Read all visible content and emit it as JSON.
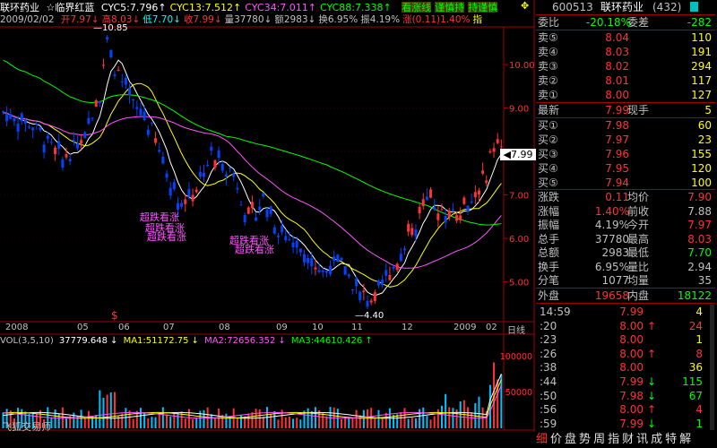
{
  "header": {
    "stock_name": "联环药业",
    "indicator_name": "☆临界红蓝",
    "cyc": [
      {
        "label": "CYC5:7.796",
        "arrow": "↑",
        "color": "#ffffff"
      },
      {
        "label": "CYC13:7.512",
        "arrow": "↑",
        "color": "#ffff00"
      },
      {
        "label": "CYC34:7.011",
        "arrow": "↑",
        "color": "#ff55ff"
      },
      {
        "label": "CYC88:7.338",
        "arrow": "↑",
        "color": "#00ff00"
      }
    ],
    "tags": [
      "看涨线",
      "谨慎持",
      "持谨慎"
    ],
    "date": "2009/02/02",
    "ohlc": [
      {
        "label": "开7.97",
        "arrow": "↓",
        "color": "#ff3333"
      },
      {
        "label": "高8.03",
        "arrow": "↓",
        "color": "#ff3333"
      },
      {
        "label": "低7.70",
        "arrow": "↓",
        "color": "#00ffff"
      },
      {
        "label": "收7.99",
        "arrow": "↓",
        "color": "#ff3333"
      },
      {
        "label": "量37780",
        "arrow": "↓",
        "color": "#c0c0c0"
      },
      {
        "label": "额2983",
        "arrow": "↓",
        "color": "#c0c0c0"
      },
      {
        "label": "换6.95%",
        "arrow": "",
        "color": "#c0c0c0"
      },
      {
        "label": "振4.19%",
        "arrow": "",
        "color": "#c0c0c0"
      },
      {
        "label": "涨(0.11)1.40%",
        "arrow": "",
        "color": "#ff3333"
      },
      {
        "label": "指",
        "arrow": "",
        "color": "#ffff00"
      }
    ]
  },
  "chart": {
    "price_axis": [
      "10.00",
      "9.00",
      "8.00",
      "7.00",
      "6.00",
      "5.00"
    ],
    "high_label": "10.85",
    "low_label": "4.40",
    "current_price": "7.99",
    "months": [
      "2008",
      "05",
      "06",
      "07",
      "08",
      "09",
      "10",
      "11",
      "12",
      "2009",
      "02"
    ],
    "period_label": "日线",
    "annotation": "超跌看涨",
    "volume_axis": [
      "100000",
      "50000"
    ],
    "watermark": "飞狐交易师"
  },
  "volume": {
    "label": "VOL(3,5,10)",
    "value": "37779.648",
    "ma1": "MA1:51172.75",
    "ma2": "MA2:72656.352",
    "ma3": "MA3:44610.426"
  },
  "quote": {
    "code": "600513",
    "name": "联环药业",
    "count": "(432)",
    "weibi_label": "委比",
    "weibi_value": "-20.18%",
    "weicha_label": "委差",
    "weicha_value": "-282",
    "sell": [
      {
        "label": "卖⑤",
        "price": "8.04",
        "vol": "110"
      },
      {
        "label": "卖④",
        "price": "8.03",
        "vol": "191"
      },
      {
        "label": "卖③",
        "price": "8.02",
        "vol": "294"
      },
      {
        "label": "卖②",
        "price": "8.01",
        "vol": "117"
      },
      {
        "label": "卖①",
        "price": "8.00",
        "vol": "127"
      }
    ],
    "latest_label": "最新",
    "latest_value": "7.99",
    "xianshou_label": "现手",
    "xianshou_value": "5",
    "buy": [
      {
        "label": "买①",
        "price": "7.98",
        "vol": "60"
      },
      {
        "label": "买②",
        "price": "7.97",
        "vol": "23"
      },
      {
        "label": "买③",
        "price": "7.96",
        "vol": "155"
      },
      {
        "label": "买④",
        "price": "7.95",
        "vol": "120"
      },
      {
        "label": "买⑤",
        "price": "7.94",
        "vol": "100"
      }
    ],
    "stats": [
      {
        "l": "涨跌",
        "v": "0.11",
        "vc": "#ff3333",
        "l2": "均价",
        "v2": "7.90",
        "v2c": "#ff3333"
      },
      {
        "l": "涨幅",
        "v": "1.40%",
        "vc": "#ff3333",
        "l2": "前收",
        "v2": "7.88",
        "v2c": "#c0c0c0"
      },
      {
        "l": "振幅",
        "v": "4.19%",
        "vc": "#c0c0c0",
        "l2": "今开",
        "v2": "7.97",
        "v2c": "#ff3333"
      },
      {
        "l": "总手",
        "v": "37780",
        "vc": "#c0c0c0",
        "l2": "最高",
        "v2": "8.03",
        "v2c": "#ff3333"
      },
      {
        "l": "总额",
        "v": "2983",
        "vc": "#c0c0c0",
        "l2": "最低",
        "v2": "7.70",
        "v2c": "#00ff00"
      },
      {
        "l": "换手",
        "v": "6.95%",
        "vc": "#c0c0c0",
        "l2": "量比",
        "v2": "2.94",
        "v2c": "#c0c0c0"
      },
      {
        "l": "分笔",
        "v": "1077",
        "vc": "#c0c0c0",
        "l2": "均量",
        "v2": "35",
        "v2c": "#c0c0c0"
      }
    ],
    "waipan_label": "外盘",
    "waipan_value": "19658",
    "neipan_label": "内盘",
    "neipan_value": "18122",
    "ticks": [
      {
        "t": "14:59",
        "p": "7.99",
        "pc": "#ff3333",
        "a": "",
        "v": "4",
        "vc": "#ffff00"
      },
      {
        "t": ":20",
        "p": "8.00",
        "pc": "#ff3333",
        "a": "↑",
        "ac": "#ff3333",
        "v": "24",
        "vc": "#ff3333"
      },
      {
        "t": ":23",
        "p": "8.00",
        "pc": "#ff3333",
        "a": "",
        "v": "1",
        "vc": "#ffff00"
      },
      {
        "t": ":26",
        "p": "8.00",
        "pc": "#ff3333",
        "a": "↑",
        "ac": "#ff3333",
        "v": "8",
        "vc": "#ff3333"
      },
      {
        "t": ":38",
        "p": "8.00",
        "pc": "#ff3333",
        "a": "",
        "v": "36",
        "vc": "#ffff00"
      },
      {
        "t": ":44",
        "p": "7.99",
        "pc": "#ff3333",
        "a": "↓",
        "ac": "#00ff00",
        "v": "115",
        "vc": "#00ff00"
      },
      {
        "t": ":50",
        "p": "7.98",
        "pc": "#ff3333",
        "a": "↓",
        "ac": "#00ff00",
        "v": "67",
        "vc": "#00ff00"
      },
      {
        "t": ":56",
        "p": "8.00",
        "pc": "#ff3333",
        "a": "↑",
        "ac": "#ff3333",
        "v": "4",
        "vc": "#ff3333"
      },
      {
        "t": ":59",
        "p": "7.99",
        "pc": "#ff3333",
        "a": "↓",
        "ac": "#00ff00",
        "v": "1",
        "vc": "#00ff00"
      }
    ],
    "tabs": [
      "细",
      "价",
      "盘",
      "势",
      "周",
      "指",
      "财",
      "讯",
      "成",
      "特",
      "解"
    ]
  }
}
